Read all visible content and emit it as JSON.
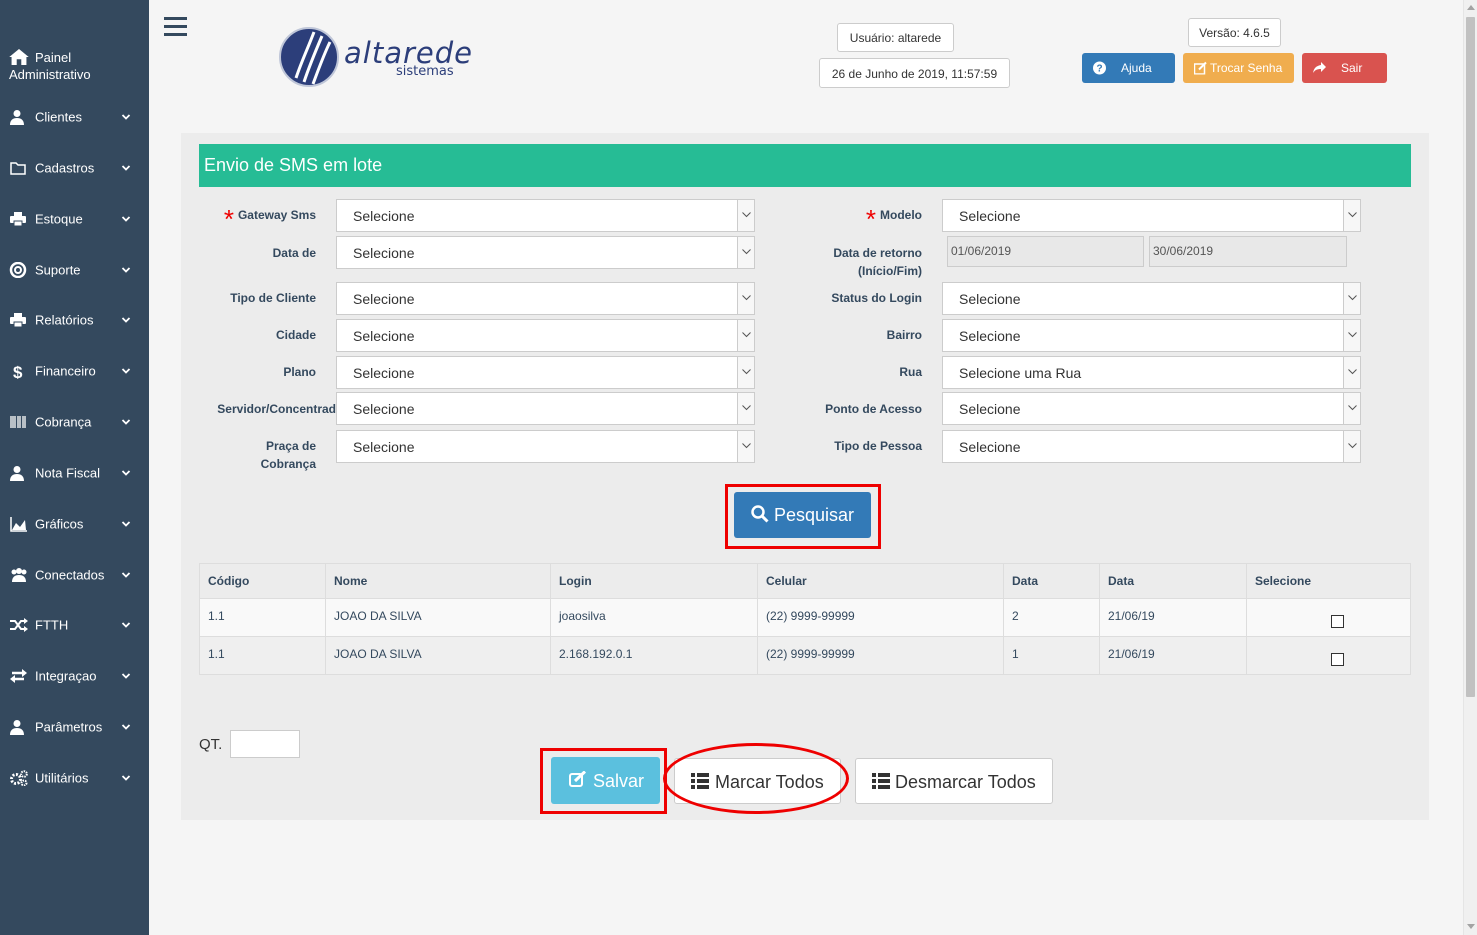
{
  "sidebar": {
    "items": [
      {
        "label": "Painel\nAdministrativo",
        "icon": "home-icon"
      },
      {
        "label": "Clientes",
        "icon": "user-icon"
      },
      {
        "label": "Cadastros",
        "icon": "folder-icon"
      },
      {
        "label": "Estoque",
        "icon": "print-icon"
      },
      {
        "label": "Suporte",
        "icon": "support-icon"
      },
      {
        "label": "Relatórios",
        "icon": "print-icon"
      },
      {
        "label": "Financeiro",
        "icon": "dollar-icon"
      },
      {
        "label": "Cobrança",
        "icon": "barcode-icon"
      },
      {
        "label": "Nota Fiscal",
        "icon": "user-icon"
      },
      {
        "label": "Gráficos",
        "icon": "area-chart-icon"
      },
      {
        "label": "Conectados",
        "icon": "users-icon"
      },
      {
        "label": "FTTH",
        "icon": "random-icon"
      },
      {
        "label": "Integraçao",
        "icon": "exchange-icon"
      },
      {
        "label": "Parâmetros",
        "icon": "user-icon"
      },
      {
        "label": "Utilitários",
        "icon": "cogs-icon"
      }
    ]
  },
  "header": {
    "logo_text": "altarede",
    "logo_sub": "sistemas",
    "user": "Usuário: altarede",
    "datetime": "26 de Junho de 2019, 11:57:59",
    "version": "Versão: 4.6.5",
    "help_label": "Ajuda",
    "change_pwd_label": "Trocar Senha",
    "logout_label": "Sair",
    "colors": {
      "help": "#337ab7",
      "change_pwd": "#f0ad4e",
      "logout": "#d9534f"
    }
  },
  "form": {
    "title": "Envio de SMS em lote",
    "left": [
      {
        "label": "Gateway Sms",
        "value": "Selecione",
        "required": true
      },
      {
        "label": "Data de",
        "value": "Selecione"
      },
      {
        "label": "Tipo de Cliente",
        "value": "Selecione"
      },
      {
        "label": "Cidade",
        "value": "Selecione"
      },
      {
        "label": "Plano",
        "value": "Selecione"
      },
      {
        "label": "Servidor/Concentrad",
        "value": "Selecione"
      },
      {
        "label": "Praça de\nCobrança",
        "value": "Selecione"
      }
    ],
    "right": [
      {
        "label": "Modelo",
        "value": "Selecione",
        "required": true
      },
      {
        "label": "Data de retorno\n(Início/Fim)",
        "date_start": "01/06/2019",
        "date_end": "30/06/2019"
      },
      {
        "label": "Status do Login",
        "value": "Selecione"
      },
      {
        "label": "Bairro",
        "value": "Selecione"
      },
      {
        "label": "Rua",
        "value": "Selecione uma Rua"
      },
      {
        "label": "Ponto de Acesso",
        "value": "Selecione"
      },
      {
        "label": "Tipo de Pessoa",
        "value": "Selecione"
      }
    ],
    "search_label": "Pesquisar"
  },
  "table": {
    "headers": [
      "Código",
      "Nome",
      "Login",
      "Celular",
      "Data",
      "Data",
      "Selecione"
    ],
    "rows": [
      [
        "1.1",
        "JOAO DA SILVA",
        "joaosilva",
        "(22) 9999-99999",
        "2",
        "21/06/19"
      ],
      [
        "1.1",
        "JOAO DA SILVA",
        "2.168.192.0.1",
        "(22) 9999-99999",
        "1",
        "21/06/19"
      ]
    ]
  },
  "footer": {
    "qt_label": "QT.",
    "qt_value": "",
    "save_label": "Salvar",
    "mark_all_label": "Marcar Todos",
    "unmark_all_label": "Desmarcar Todos"
  }
}
